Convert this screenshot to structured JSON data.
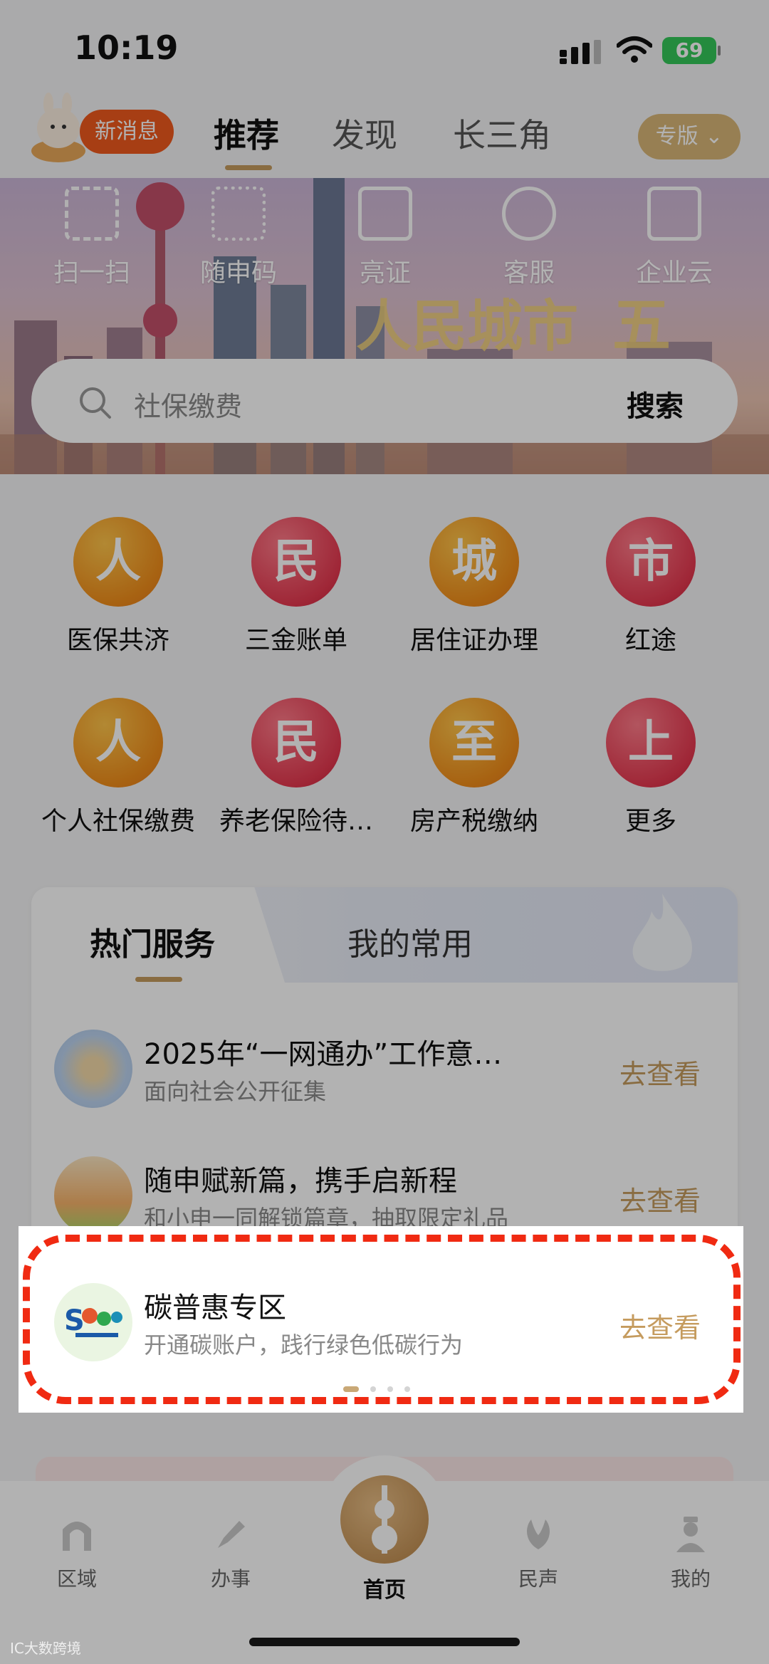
{
  "status_bar": {
    "time": "10:19",
    "battery": "69"
  },
  "header": {
    "new_message": "新消息",
    "tabs": [
      "推荐",
      "发现",
      "长三角"
    ],
    "edition": "专版 ⌄"
  },
  "quick_actions": [
    "扫一扫",
    "随申码",
    "亮证",
    "客服",
    "企业云"
  ],
  "search": {
    "placeholder": "社保缴费",
    "button": "搜索"
  },
  "services": [
    {
      "badge": "人",
      "name": "医保共济",
      "color": "orange"
    },
    {
      "badge": "民",
      "name": "三金账单",
      "color": "red"
    },
    {
      "badge": "城",
      "name": "居住证办理",
      "color": "orange"
    },
    {
      "badge": "市",
      "name": "红途",
      "color": "red"
    },
    {
      "badge": "人",
      "name": "个人社保缴费",
      "color": "orange"
    },
    {
      "badge": "民",
      "name": "养老保险待…",
      "color": "red"
    },
    {
      "badge": "至",
      "name": "房产税缴纳",
      "color": "orange"
    },
    {
      "badge": "上",
      "name": "更多",
      "color": "red"
    }
  ],
  "hot_card": {
    "tabs": [
      "热门服务",
      "我的常用"
    ],
    "items": [
      {
        "title": "2025年“一网通办”工作意…",
        "subtitle": "面向社会公开征集",
        "action": "去查看"
      },
      {
        "title": "随申赋新篇，携手启新程",
        "subtitle": "和小申一同解锁篇章，抽取限定礼品",
        "action": "去查看"
      },
      {
        "title": "碳普惠专区",
        "subtitle": "开通碳账户，践行绿色低碳行为",
        "action": "去查看"
      }
    ]
  },
  "bottom_nav": [
    "区域",
    "办事",
    "首页",
    "民声",
    "我的"
  ],
  "colors": {
    "accent": "#c59b5e",
    "highlight": "#f02a12"
  }
}
